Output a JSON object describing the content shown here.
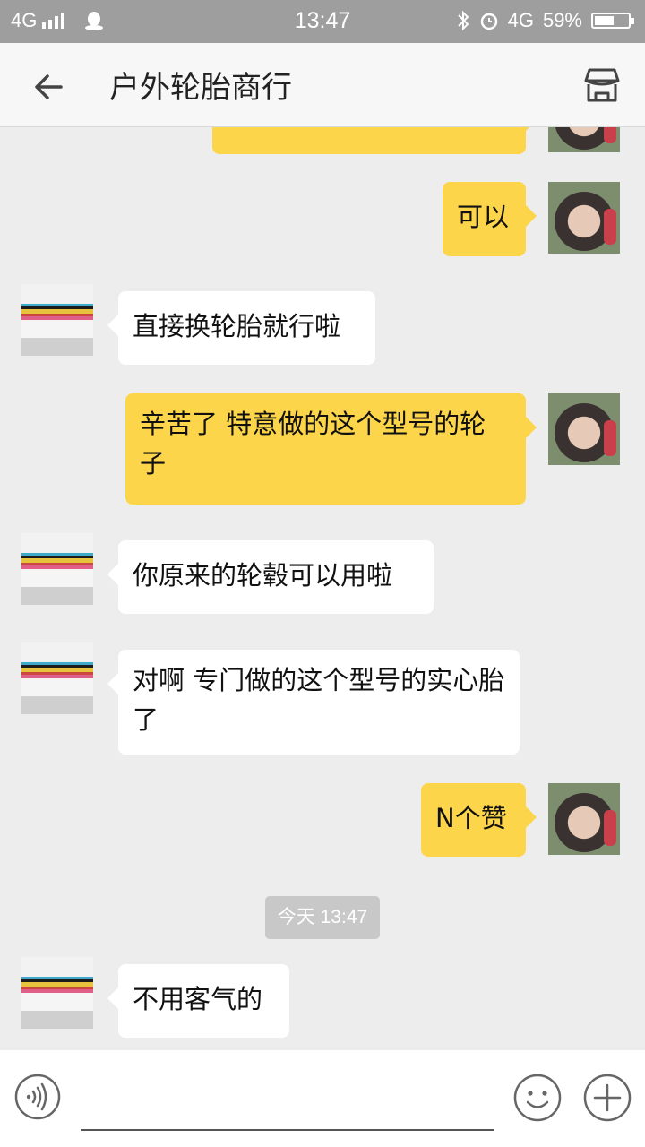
{
  "status_bar": {
    "network": "4G",
    "time": "13:47",
    "right_network": "4G",
    "battery": "59%",
    "battery_level": 0.59
  },
  "header": {
    "title": "户外轮胎商行",
    "back_icon": "arrow-left-icon",
    "store_icon": "store-icon"
  },
  "messages": [
    {
      "from": "me",
      "text": ""
    },
    {
      "from": "me",
      "text": "可以"
    },
    {
      "from": "shop",
      "text": "直接换轮胎就行啦"
    },
    {
      "from": "me",
      "text": "辛苦了  特意做的这个型号的轮子"
    },
    {
      "from": "shop",
      "text": "你原来的轮毂可以用啦"
    },
    {
      "from": "shop",
      "text": "对啊 专门做的这个型号的实心胎了"
    },
    {
      "from": "me",
      "text": "N个赞"
    },
    {
      "from": "shop",
      "text": "不用客气的"
    }
  ],
  "timestamp": "今天 13:47",
  "input_bar": {
    "voice_icon": "voice-icon",
    "emoji_icon": "emoji-icon",
    "plus_icon": "plus-icon",
    "value": "",
    "placeholder": ""
  },
  "colors": {
    "status_bar": "#9e9e9e",
    "header": "#f7f7f7",
    "chat_background": "#ededed",
    "my_bubble": "#fcd54a",
    "their_bubble": "#ffffff"
  }
}
